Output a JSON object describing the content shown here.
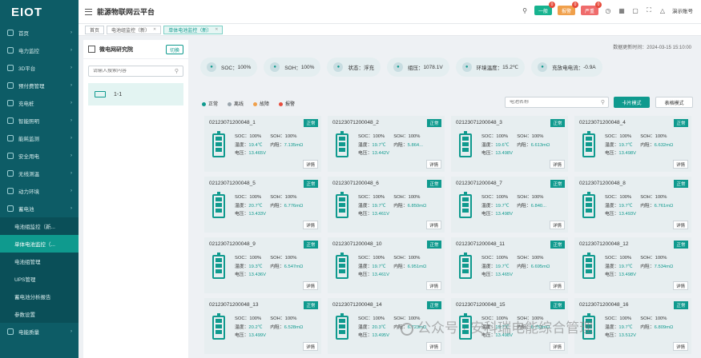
{
  "app": {
    "logo": "EIOT",
    "title": "能源物联网云平台"
  },
  "colors": {
    "accent": "#0f9a8e",
    "sidebar_bg": "#0d5c66",
    "pill_green": "#17b38f",
    "pill_orange": "#f0a04b",
    "pill_red": "#ef6b6b"
  },
  "sidebar": {
    "items": [
      {
        "label": "首页",
        "icon": "home-icon"
      },
      {
        "label": "电力监控",
        "icon": "power-icon"
      },
      {
        "label": "3D平台",
        "icon": "cube-icon"
      },
      {
        "label": "预付费管理",
        "icon": "wallet-icon"
      },
      {
        "label": "充电桩",
        "icon": "charger-icon"
      },
      {
        "label": "智能照明",
        "icon": "bulb-icon"
      },
      {
        "label": "能耗监测",
        "icon": "chart-icon"
      },
      {
        "label": "安全用电",
        "icon": "shield-icon"
      },
      {
        "label": "无线测温",
        "icon": "thermometer-icon"
      },
      {
        "label": "动力环境",
        "icon": "environment-icon"
      },
      {
        "label": "蓄电池",
        "icon": "battery-icon"
      }
    ],
    "sub_items": [
      {
        "label": "电池组监控（新..."
      },
      {
        "label": "单体电池监控（..."
      },
      {
        "label": "电池组管理"
      },
      {
        "label": "UPS管理"
      },
      {
        "label": "蓄电池分析报告"
      },
      {
        "label": "参数设置"
      }
    ],
    "bottom_item": {
      "label": "电能质量",
      "icon": "wave-icon"
    }
  },
  "topbar": {
    "pills": [
      {
        "label": "一般",
        "count": "0"
      },
      {
        "label": "报警",
        "count": "0"
      },
      {
        "label": "严重",
        "count": "0"
      }
    ],
    "user": "演示账号"
  },
  "tabs": [
    {
      "label": "首页"
    },
    {
      "label": "电池组监控（新）"
    },
    {
      "label": "单体电池监控（新）"
    }
  ],
  "left_panel": {
    "title": "微电网研究院",
    "button": "切换",
    "search_placeholder": "请输入搜索内容",
    "tree_item": "1-1"
  },
  "main": {
    "datetime": "数据更新时间：2024-03-15 15:10:00",
    "kpis": [
      {
        "label": "SOC：",
        "value": "100%"
      },
      {
        "label": "SOH：",
        "value": "100%"
      },
      {
        "label": "状态：",
        "value": "浮充"
      },
      {
        "label": "组压：",
        "value": "1078.1V"
      },
      {
        "label": "环境温度：",
        "value": "15.2℃"
      },
      {
        "label": "充放电电流：",
        "value": "-0.9A"
      }
    ],
    "legend": [
      {
        "label": "正常",
        "color": "#0f9a8e"
      },
      {
        "label": "离线",
        "color": "#9aa5ad"
      },
      {
        "label": "故障",
        "color": "#f0a04b"
      },
      {
        "label": "报警",
        "color": "#e74c3c"
      }
    ],
    "cell_search_placeholder": "电池名称",
    "grid_button": "卡片模式",
    "table_button": "表格模式",
    "labels": {
      "soc": "SOC：",
      "soh": "SOH：",
      "temp": "温度：",
      "res": "内阻：",
      "volt": "电压：",
      "detail": "详情"
    },
    "cells": [
      {
        "id": "02123071200048_1",
        "status": "正常",
        "soc": "100%",
        "soh": "100%",
        "temp": "19.4℃",
        "res": "7.135mΩ",
        "volt": "13.465V"
      },
      {
        "id": "02123071200048_2",
        "status": "正常",
        "soc": "100%",
        "soh": "100%",
        "temp": "19.7℃",
        "res": "5.864...",
        "volt": "13.442V"
      },
      {
        "id": "02123071200048_3",
        "status": "正常",
        "soc": "100%",
        "soh": "100%",
        "temp": "19.6℃",
        "res": "6.613mΩ",
        "volt": "13.498V"
      },
      {
        "id": "02123071200048_4",
        "status": "正常",
        "soc": "100%",
        "soh": "100%",
        "temp": "19.7℃",
        "res": "6.632mΩ",
        "volt": "13.498V"
      },
      {
        "id": "02123071200048_5",
        "status": "正常",
        "soc": "100%",
        "soh": "100%",
        "temp": "20.7℃",
        "res": "6.776mΩ",
        "volt": "13.433V"
      },
      {
        "id": "02123071200048_6",
        "status": "正常",
        "soc": "100%",
        "soh": "100%",
        "temp": "19.7℃",
        "res": "6.850mΩ",
        "volt": "13.461V"
      },
      {
        "id": "02123071200048_7",
        "status": "正常",
        "soc": "100%",
        "soh": "100%",
        "temp": "19.7℃",
        "res": "6.840...",
        "volt": "13.498V"
      },
      {
        "id": "02123071200048_8",
        "status": "正常",
        "soc": "100%",
        "soh": "100%",
        "temp": "19.7℃",
        "res": "6.761mΩ",
        "volt": "13.493V"
      },
      {
        "id": "02123071200048_9",
        "status": "正常",
        "soc": "100%",
        "soh": "100%",
        "temp": "19.3℃",
        "res": "6.547mΩ",
        "volt": "13.436V"
      },
      {
        "id": "02123071200048_10",
        "status": "正常",
        "soc": "100%",
        "soh": "100%",
        "temp": "19.7℃",
        "res": "6.951mΩ",
        "volt": "13.461V"
      },
      {
        "id": "02123071200048_11",
        "status": "正常",
        "soc": "100%",
        "soh": "100%",
        "temp": "19.7℃",
        "res": "6.695mΩ",
        "volt": "13.465V"
      },
      {
        "id": "02123071200048_12",
        "status": "正常",
        "soc": "100%",
        "soh": "100%",
        "temp": "19.7℃",
        "res": "7.534mΩ",
        "volt": "13.498V"
      },
      {
        "id": "02123071200048_13",
        "status": "正常",
        "soc": "100%",
        "soh": "100%",
        "temp": "20.2℃",
        "res": "6.528mΩ",
        "volt": "13.499V"
      },
      {
        "id": "02123071200048_14",
        "status": "正常",
        "soc": "100%",
        "soh": "100%",
        "temp": "20.3℃",
        "res": "6.723mΩ",
        "volt": "13.495V"
      },
      {
        "id": "02123071200048_15",
        "status": "正常",
        "soc": "100%",
        "soh": "100%",
        "temp": "19.7℃",
        "res": "6.753mΩ",
        "volt": "13.498V"
      },
      {
        "id": "02123071200048_16",
        "status": "正常",
        "soc": "100%",
        "soh": "100%",
        "temp": "19.7℃",
        "res": "6.809mΩ",
        "volt": "13.512V"
      }
    ]
  },
  "watermark": "公众号 · 安科瑞电能综合管理"
}
